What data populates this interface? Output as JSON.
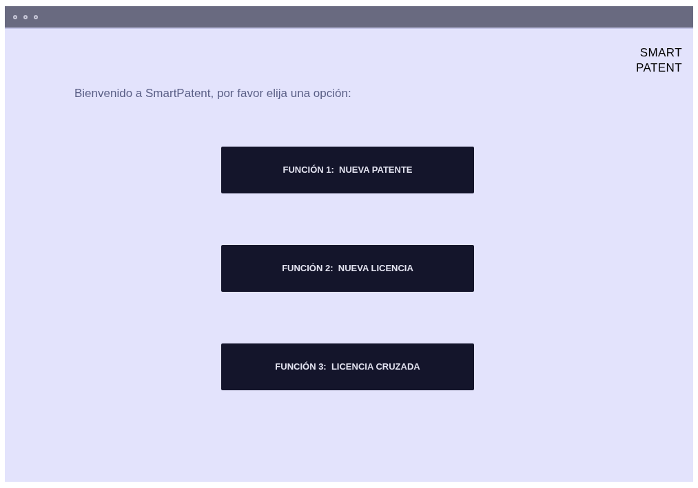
{
  "logo": "SMART PATENT",
  "welcome": "Bienvenido a SmartPatent, por favor elija una opción:",
  "buttons": [
    "FUNCIÓN 1:  NUEVA PATENTE",
    "FUNCIÓN 2:  NUEVA LICENCIA",
    "FUNCIÓN 3:  LICENCIA CRUZADA"
  ]
}
